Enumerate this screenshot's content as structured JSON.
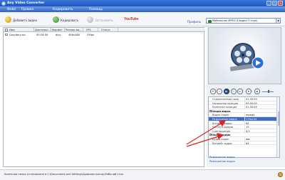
{
  "window": {
    "title": "Any Video Converter",
    "buttons": [
      "_",
      "□",
      "×"
    ]
  },
  "menu": {
    "items": [
      "Файл",
      "Правка",
      "Кодировать",
      "Помощь"
    ]
  },
  "toolbar": {
    "add_video": "Добавить видео",
    "encode": "Кодировать",
    "stop": "Остановить",
    "youtube": "YouTube",
    "profile_label": "Профиль",
    "profile_value": "Мобильник MPEG-4 видео (*.mp4)"
  },
  "filelist": {
    "columns": [
      "Имя",
      "Длительн...",
      "Формат",
      "Размер ви...",
      "FPS",
      "Статус"
    ],
    "rows": [
      {
        "name": "Gravitery.avi",
        "duration": "00:16:50",
        "format": "divx",
        "size": "496x288",
        "fps": "25fps",
        "status": ""
      }
    ]
  },
  "player": {
    "controls": [
      "⏮",
      "◁",
      "▶",
      "▷",
      "⏭",
      "⏹"
    ],
    "volume": 0.5
  },
  "properties": {
    "rows": [
      {
        "label": "Ограниченные поля",
        "value": "01:30:59",
        "type": "row"
      },
      {
        "label": "Начальная позиция",
        "value": "00:00:00",
        "type": "row"
      },
      {
        "label": "Конечная позиция",
        "value": "01:30:59",
        "type": "row"
      },
      {
        "label": "Опции видео",
        "value": "",
        "type": "group"
      },
      {
        "label": "Видео кодек",
        "value": "mpeg4",
        "type": "row"
      },
      {
        "label": "Разрешение видео",
        "value": "176x144",
        "type": "selected"
      },
      {
        "label": "Битрейт видео",
        "value": "64",
        "type": "row"
      },
      {
        "label": "Частота кадров",
        "value": "15",
        "type": "row"
      },
      {
        "label": "Соотношение",
        "value": "4:3",
        "type": "row"
      },
      {
        "label": "Опции аудио",
        "value": "",
        "type": "group"
      },
      {
        "label": "Аудио кодек",
        "value": "aac",
        "type": "row"
      },
      {
        "label": "Битрейт аудио",
        "value": "64",
        "type": "row"
      }
    ],
    "description_title": "Разрешение видео",
    "description_text": "Разрешение видео"
  },
  "status": {
    "text": "Конечная папка установлена в C:\\Documents and Settings\\Администратор\\Рабочий стол"
  },
  "colors": {
    "titlebar": "#1c56c0",
    "selected_row": "#3d6cc4",
    "arrow": "#e02020",
    "link": "#1f55b0"
  }
}
